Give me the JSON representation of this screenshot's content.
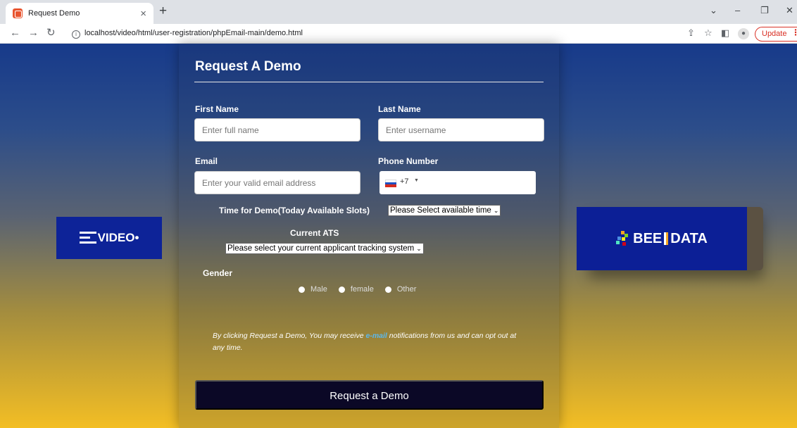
{
  "browser": {
    "tab_title": "Request Demo",
    "tab_close": "×",
    "new_tab": "+",
    "url": "localhost/video/html/user-registration/phpEmail-main/demo.html",
    "update_label": "Update",
    "window_controls": {
      "minimize": "–",
      "restore": "❐",
      "close": "✕",
      "dropdown": "⌄"
    }
  },
  "left_logo": {
    "text": "VIDEO",
    "suffix": "•"
  },
  "right_logo": {
    "text_left": "BEE",
    "text_right": "DATA"
  },
  "form": {
    "title": "Request A Demo",
    "first_name": {
      "label": "First Name",
      "placeholder": "Enter full name"
    },
    "last_name": {
      "label": "Last Name",
      "placeholder": "Enter username"
    },
    "email": {
      "label": "Email",
      "placeholder": "Enter your valid email address"
    },
    "phone": {
      "label": "Phone Number",
      "dial_code": "+7"
    },
    "demo_time": {
      "label": "Time for Demo(Today Available Slots)",
      "selected": "Please Select available time"
    },
    "ats": {
      "label": "Current ATS",
      "selected": "Please select your current applicant tracking system"
    },
    "gender": {
      "label": "Gender",
      "options": [
        "Male",
        "female",
        "Other"
      ]
    },
    "note": {
      "before": "By clicking Request a Demo, You may receive ",
      "link": "e-mail",
      "after": " notifications from us and can opt out at any time."
    },
    "submit_label": "Request a Demo"
  },
  "colors": {
    "left_logo_bg": "#0d2398",
    "right_logo_bg": "#0c1f96",
    "submit_bg": "#0b0826",
    "link": "#5bb8ee"
  }
}
